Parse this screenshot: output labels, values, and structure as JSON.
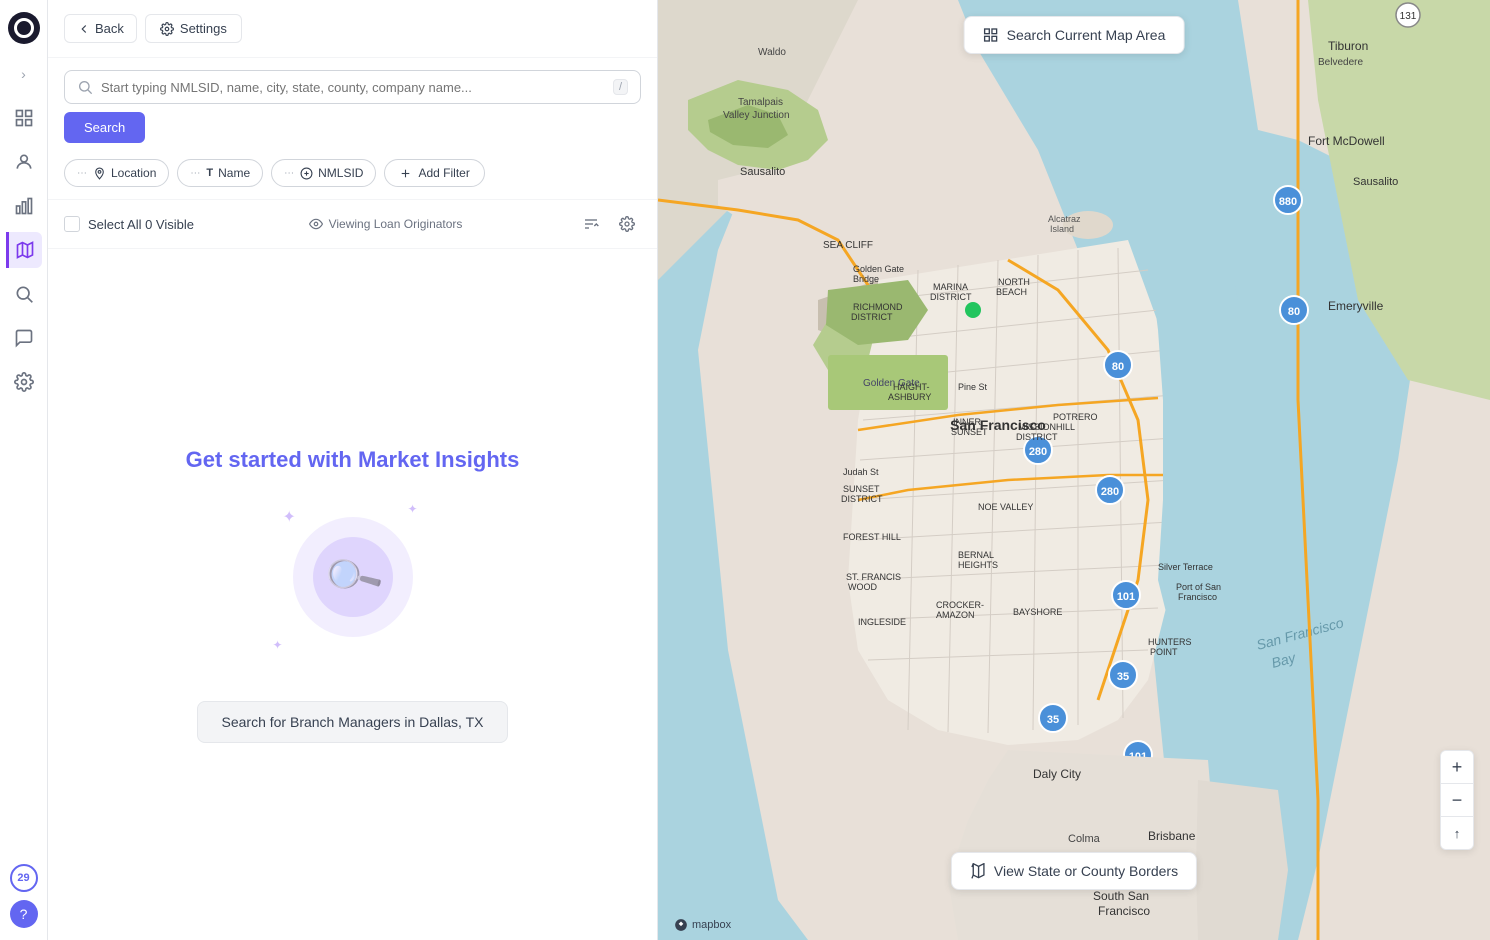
{
  "sidebar": {
    "logo_alt": "App Logo",
    "expand_icon": "›",
    "icons": [
      {
        "name": "grid-icon",
        "symbol": "⊞",
        "active": false
      },
      {
        "name": "users-icon",
        "symbol": "👤",
        "active": false
      },
      {
        "name": "chart-icon",
        "symbol": "📊",
        "active": false
      },
      {
        "name": "map-pin-icon",
        "symbol": "📍",
        "active": true
      },
      {
        "name": "search-icon",
        "symbol": "🔍",
        "active": false
      },
      {
        "name": "comment-icon",
        "symbol": "💬",
        "active": false
      },
      {
        "name": "settings-icon",
        "symbol": "⚙",
        "active": false
      }
    ],
    "badge_count": "29",
    "help_icon": "?"
  },
  "header": {
    "back_label": "Back",
    "settings_label": "Settings"
  },
  "search_bar": {
    "placeholder": "Start typing NMLSID, name, city, state, county, company name...",
    "slash_badge": "/",
    "button_label": "Search"
  },
  "filter_tabs": [
    {
      "id": "location",
      "icon": "📍",
      "label": "Location"
    },
    {
      "id": "name",
      "icon": "T",
      "label": "Name"
    },
    {
      "id": "nmlsid",
      "icon": "🔗",
      "label": "NMLSID"
    }
  ],
  "add_filter_label": "Add Filter",
  "results": {
    "select_all_label": "Select All 0 Visible",
    "viewing_label": "Viewing Loan Originators"
  },
  "empty_state": {
    "title": "Get started with Market Insights",
    "suggestion_label": "Search for Branch Managers in Dallas, TX"
  },
  "map": {
    "search_area_label": "Search Current Map Area",
    "borders_label": "View State or County Borders",
    "zoom_in": "+",
    "zoom_out": "−",
    "compass": "↑",
    "attribution": "mapbox"
  }
}
